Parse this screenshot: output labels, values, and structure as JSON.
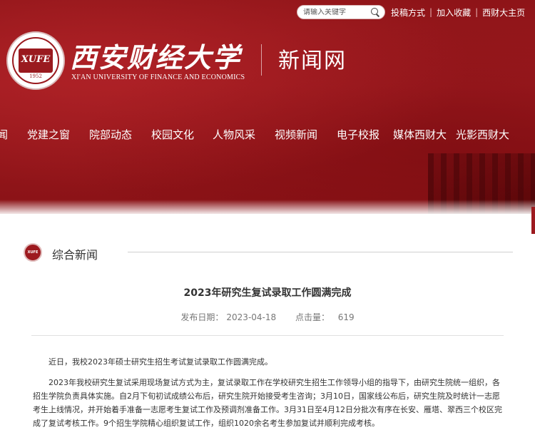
{
  "header": {
    "search": {
      "placeholder": "请输入关键字"
    },
    "links": [
      "投稿方式",
      "加入收藏",
      "西财大主页"
    ],
    "logo": {
      "seal_text": "XUFE",
      "seal_year": "1952",
      "title_cn": "西安财经大学",
      "title_en": "XI'AN UNIVERSITY OF FINANCE AND ECONOMICS"
    },
    "site_name": "新闻网"
  },
  "nav": {
    "items": [
      "闻",
      "党建之窗",
      "院部动态",
      "校园文化",
      "人物风采",
      "视频新闻",
      "电子校报",
      "媒体西财大",
      "光影西财大"
    ]
  },
  "section": {
    "title": "综合新闻"
  },
  "article": {
    "title": "2023年研究生复试录取工作圆满完成",
    "meta": {
      "date_label": "发布日期：",
      "date": "2023-04-18",
      "clicks_label": "点击量：",
      "clicks": "619"
    },
    "paragraphs": [
      "近日，我校2023年硕士研究生招生考试复试录取工作圆满完成。",
      "2023年我校研究生复试采用现场复试方式为主，复试录取工作在学校研究生招生工作领导小组的指导下，由研究生院统一组织，各招生学院负责具体实施。自2月下旬初试成绩公布后，研究生院开始接受考生咨询；3月10日，国家线公布后，研究生院及时统计一志愿考生上线情况，并开始着手准备一志愿考生复试工作及预调剂准备工作。3月31日至4月12日分批次有序在长安、雁塔、翠西三个校区完成了复试考核工作。9个招生学院精心组织复试工作，组织1020余名考生参加复试并顺利完成考核。"
    ]
  },
  "colors": {
    "brand_red": "#9d1a1f",
    "text": "#333333",
    "meta": "#777777"
  }
}
